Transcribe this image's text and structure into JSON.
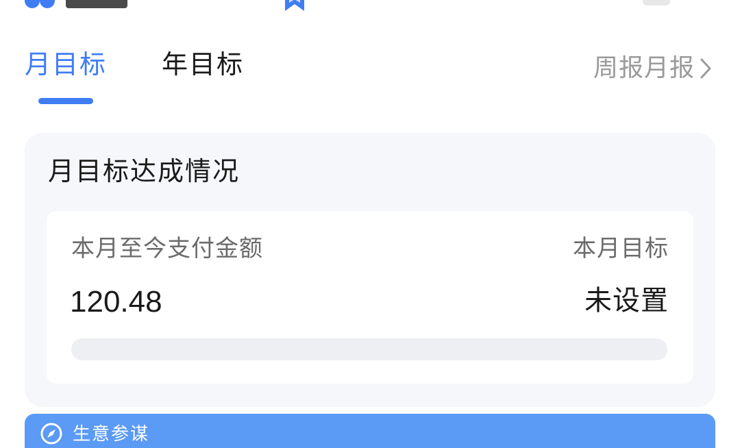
{
  "tabs": [
    {
      "label": "月目标",
      "active": true
    },
    {
      "label": "年目标",
      "active": false
    }
  ],
  "report_link": {
    "label": "周报月报"
  },
  "card": {
    "title": "月目标达成情况",
    "paid_label": "本月至今支付金额",
    "paid_value": "120.48",
    "target_label": "本月目标",
    "target_value": "未设置",
    "progress_fraction": 0
  },
  "banner": {
    "label": "生意参谋"
  },
  "colors": {
    "accent": "#3f7df5",
    "card_bg": "#f5f7fb",
    "banner_bg": "#5b9af5",
    "muted_text": "#9a9a9a"
  },
  "icons": {
    "report_link": "chevron-right-icon",
    "banner": "compass-icon",
    "top_logo": "app-logo-icon",
    "top_bookmark": "bookmark-icon"
  }
}
